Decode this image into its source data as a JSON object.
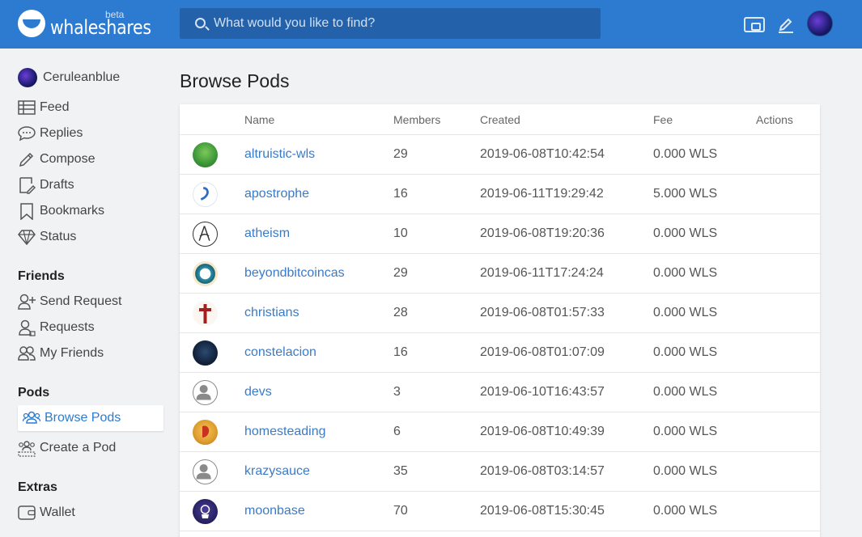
{
  "header": {
    "logo_text": "whaleshares",
    "logo_badge": "beta",
    "search_placeholder": "What would you like to find?",
    "icons": [
      "wallet-icon",
      "pencil-icon",
      "user-avatar"
    ]
  },
  "sidebar": {
    "user": "Ceruleanblue",
    "main_items": [
      {
        "label": "Feed",
        "icon": "table-icon"
      },
      {
        "label": "Replies",
        "icon": "chat-icon"
      },
      {
        "label": "Compose",
        "icon": "pencil-icon"
      },
      {
        "label": "Drafts",
        "icon": "drafts-icon"
      },
      {
        "label": "Bookmarks",
        "icon": "bookmark-icon"
      },
      {
        "label": "Status",
        "icon": "diamond-icon"
      }
    ],
    "friends_heading": "Friends",
    "friends_items": [
      {
        "label": "Send Request",
        "icon": "user-plus-icon"
      },
      {
        "label": "Requests",
        "icon": "user-icon"
      },
      {
        "label": "My Friends",
        "icon": "users-icon"
      }
    ],
    "pods_heading": "Pods",
    "pods_items": [
      {
        "label": "Browse Pods",
        "icon": "group-icon",
        "active": true
      },
      {
        "label": "Create a Pod",
        "icon": "group-add-icon"
      }
    ],
    "extras_heading": "Extras",
    "extras_items": [
      {
        "label": "Wallet",
        "icon": "wallet-icon"
      }
    ]
  },
  "main": {
    "title": "Browse Pods",
    "columns": [
      "Name",
      "Members",
      "Created",
      "Fee",
      "Actions"
    ],
    "rows": [
      {
        "name": "altruistic-wls",
        "members": "29",
        "created": "2019-06-08T10:42:54",
        "fee": "0.000 WLS",
        "icon_color": "#3f9a3a"
      },
      {
        "name": "apostrophe",
        "members": "16",
        "created": "2019-06-11T19:29:42",
        "fee": "5.000 WLS",
        "icon_color": "#2a6fc4"
      },
      {
        "name": "atheism",
        "members": "10",
        "created": "2019-06-08T19:20:36",
        "fee": "0.000 WLS",
        "icon_color": "#333333"
      },
      {
        "name": "beyondbitcoincas",
        "members": "29",
        "created": "2019-06-11T17:24:24",
        "fee": "0.000 WLS",
        "icon_color": "#2b8fa8"
      },
      {
        "name": "christians",
        "members": "28",
        "created": "2019-06-08T01:57:33",
        "fee": "0.000 WLS",
        "icon_color": "#a01f1f"
      },
      {
        "name": "constelacion",
        "members": "16",
        "created": "2019-06-08T01:07:09",
        "fee": "0.000 WLS",
        "icon_color": "#12233d"
      },
      {
        "name": "devs",
        "members": "3",
        "created": "2019-06-10T16:43:57",
        "fee": "0.000 WLS",
        "icon_color": "#8a8a8a"
      },
      {
        "name": "homesteading",
        "members": "6",
        "created": "2019-06-08T10:49:39",
        "fee": "0.000 WLS",
        "icon_color": "#e0a030"
      },
      {
        "name": "krazysauce",
        "members": "35",
        "created": "2019-06-08T03:14:57",
        "fee": "0.000 WLS",
        "icon_color": "#8a8a8a"
      },
      {
        "name": "moonbase",
        "members": "70",
        "created": "2019-06-08T15:30:45",
        "fee": "0.000 WLS",
        "icon_color": "#2b2466"
      }
    ]
  },
  "colors": {
    "header": "#2d7bd1",
    "link": "#3a7bc8",
    "background": "#f1f2f4"
  }
}
